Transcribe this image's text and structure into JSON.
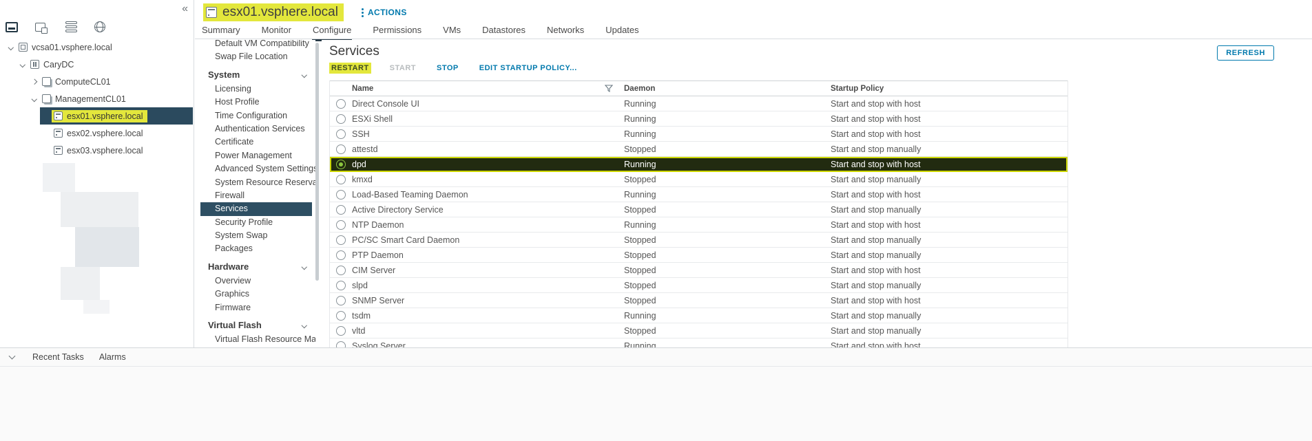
{
  "sidebar": {
    "collapse_glyph": "«",
    "toolbar_icons": [
      {
        "name": "hosts-and-clusters-icon",
        "selected": true
      },
      {
        "name": "vms-and-templates-icon"
      },
      {
        "name": "storage-icon"
      },
      {
        "name": "networking-icon"
      }
    ],
    "tree": [
      {
        "label": "vcsa01.vsphere.local",
        "level": 0,
        "icon": "vcenter-icon",
        "expanded": true
      },
      {
        "label": "CaryDC",
        "level": 1,
        "icon": "datacenter-icon",
        "expanded": true
      },
      {
        "label": "ComputeCL01",
        "level": 2,
        "icon": "cluster-icon",
        "expanded": false
      },
      {
        "label": "ManagementCL01",
        "level": 2,
        "icon": "cluster-icon",
        "expanded": true
      },
      {
        "label": "esx01.vsphere.local",
        "level": 3,
        "icon": "host-icon",
        "selected": true,
        "highlighted": true
      },
      {
        "label": "esx02.vsphere.local",
        "level": 3,
        "icon": "host-icon"
      },
      {
        "label": "esx03.vsphere.local",
        "level": 3,
        "icon": "host-icon"
      }
    ]
  },
  "header": {
    "title": "esx01.vsphere.local",
    "actions_label": "ACTIONS",
    "tabs": [
      {
        "label": "Summary"
      },
      {
        "label": "Monitor"
      },
      {
        "label": "Configure",
        "active": true
      },
      {
        "label": "Permissions"
      },
      {
        "label": "VMs"
      },
      {
        "label": "Datastores"
      },
      {
        "label": "Networks"
      },
      {
        "label": "Updates"
      }
    ]
  },
  "configure_menu": {
    "items": [
      {
        "label": "Default VM Compatibility",
        "type": "item"
      },
      {
        "label": "Swap File Location",
        "type": "item"
      },
      {
        "label": "System",
        "type": "section"
      },
      {
        "label": "Licensing",
        "type": "item"
      },
      {
        "label": "Host Profile",
        "type": "item"
      },
      {
        "label": "Time Configuration",
        "type": "item"
      },
      {
        "label": "Authentication Services",
        "type": "item"
      },
      {
        "label": "Certificate",
        "type": "item"
      },
      {
        "label": "Power Management",
        "type": "item"
      },
      {
        "label": "Advanced System Settings",
        "type": "item"
      },
      {
        "label": "System Resource Reservati...",
        "type": "item"
      },
      {
        "label": "Firewall",
        "type": "item"
      },
      {
        "label": "Services",
        "type": "item",
        "selected": true
      },
      {
        "label": "Security Profile",
        "type": "item"
      },
      {
        "label": "System Swap",
        "type": "item"
      },
      {
        "label": "Packages",
        "type": "item"
      },
      {
        "label": "Hardware",
        "type": "section"
      },
      {
        "label": "Overview",
        "type": "item"
      },
      {
        "label": "Graphics",
        "type": "item"
      },
      {
        "label": "Firmware",
        "type": "item"
      },
      {
        "label": "Virtual Flash",
        "type": "section"
      },
      {
        "label": "Virtual Flash Resource Man...",
        "type": "item"
      }
    ]
  },
  "services": {
    "title": "Services",
    "actions": [
      {
        "label": "RESTART",
        "highlighted": true
      },
      {
        "label": "START",
        "disabled": true
      },
      {
        "label": "STOP"
      },
      {
        "label": "EDIT STARTUP POLICY..."
      }
    ],
    "refresh_label": "REFRESH",
    "table": {
      "columns": [
        "Name",
        "Daemon",
        "Startup Policy"
      ],
      "rows": [
        {
          "name": "Direct Console UI",
          "daemon": "Running",
          "policy": "Start and stop with host"
        },
        {
          "name": "ESXi Shell",
          "daemon": "Running",
          "policy": "Start and stop with host"
        },
        {
          "name": "SSH",
          "daemon": "Running",
          "policy": "Start and stop with host"
        },
        {
          "name": "attestd",
          "daemon": "Stopped",
          "policy": "Start and stop manually"
        },
        {
          "name": "dpd",
          "daemon": "Running",
          "policy": "Start and stop with host",
          "selected": true,
          "highlighted": true
        },
        {
          "name": "kmxd",
          "daemon": "Stopped",
          "policy": "Start and stop manually"
        },
        {
          "name": "Load-Based Teaming Daemon",
          "daemon": "Running",
          "policy": "Start and stop with host"
        },
        {
          "name": "Active Directory Service",
          "daemon": "Stopped",
          "policy": "Start and stop manually"
        },
        {
          "name": "NTP Daemon",
          "daemon": "Running",
          "policy": "Start and stop with host"
        },
        {
          "name": "PC/SC Smart Card Daemon",
          "daemon": "Stopped",
          "policy": "Start and stop manually"
        },
        {
          "name": "PTP Daemon",
          "daemon": "Stopped",
          "policy": "Start and stop manually"
        },
        {
          "name": "CIM Server",
          "daemon": "Stopped",
          "policy": "Start and stop with host"
        },
        {
          "name": "slpd",
          "daemon": "Stopped",
          "policy": "Start and stop manually"
        },
        {
          "name": "SNMP Server",
          "daemon": "Stopped",
          "policy": "Start and stop with host"
        },
        {
          "name": "tsdm",
          "daemon": "Running",
          "policy": "Start and stop manually"
        },
        {
          "name": "vltd",
          "daemon": "Stopped",
          "policy": "Start and stop manually"
        },
        {
          "name": "Syslog Server",
          "daemon": "Running",
          "policy": "Start and stop with host"
        }
      ]
    }
  },
  "footer": {
    "tabs": [
      "Recent Tasks",
      "Alarms"
    ]
  },
  "colors": {
    "accent": "#0079ad",
    "highlight": "#e3e73c",
    "nav_selected": "#2e4f63",
    "tree_selected": "#2b4a5e",
    "row_selected_bg": "#222b10",
    "row_selected_border": "#ccd600",
    "tab_active_underline": "#283a47"
  }
}
